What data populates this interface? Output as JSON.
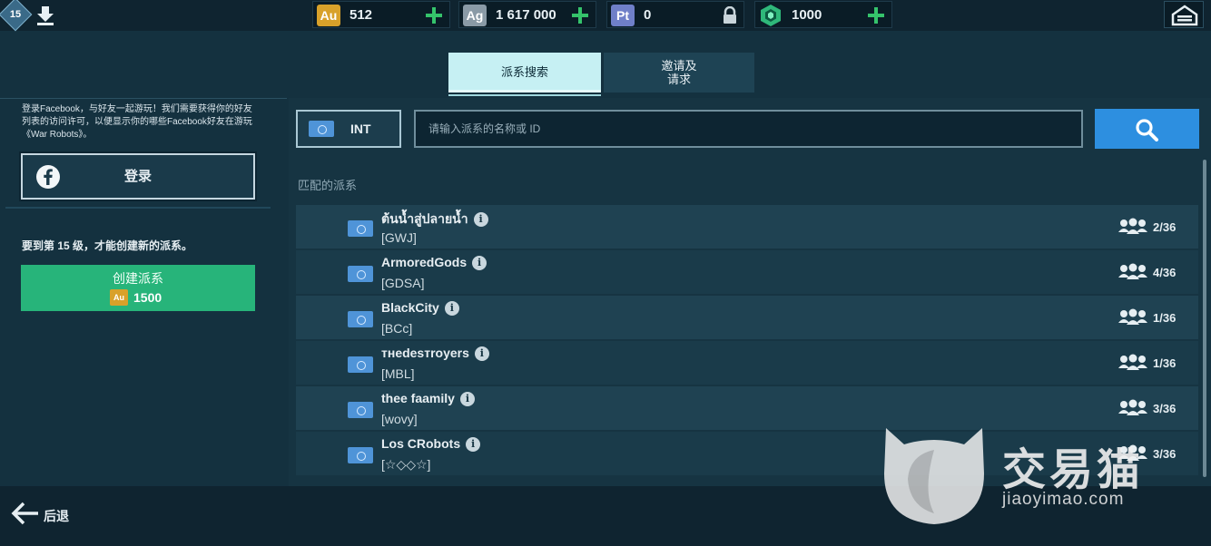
{
  "topbar": {
    "level": "15",
    "currencies": [
      {
        "icon_label": "Au",
        "name": "gold",
        "value": "512",
        "color": "#d8a12a",
        "action": "plus"
      },
      {
        "icon_label": "Ag",
        "name": "silver",
        "value": "1 617 000",
        "color": "#8a9aa6",
        "action": "plus"
      },
      {
        "icon_label": "Pt",
        "name": "platinum",
        "value": "0",
        "color": "#6f7fc8",
        "action": "lock"
      },
      {
        "icon_label": "",
        "name": "keys",
        "value": "1000",
        "color": "#2fb87a",
        "action": "plus"
      }
    ],
    "icons": {
      "download": "download-arrow-icon",
      "home": "hangar-icon",
      "plus": "plus-icon",
      "lock": "lock-icon"
    }
  },
  "tabs": [
    {
      "label": "派系搜索",
      "active": true
    },
    {
      "label": "邀请及\n请求",
      "active": false
    }
  ],
  "left_panel": {
    "facebook_text": "登录Facebook，与好友一起游玩！我们需要获得你的好友列表的访问许可，以便显示你的哪些Facebook好友在游玩《War Robots》。",
    "login_label": "登录",
    "level_requirement": "要到第 15 级，才能创建新的派系。",
    "create_label": "创建派系",
    "create_cost_icon": "Au",
    "create_cost": "1500",
    "colors": {
      "create_button": "#27b47a"
    }
  },
  "search": {
    "region_label": "INT",
    "placeholder": "请输入派系的名称或 ID",
    "value": "",
    "section_label": "匹配的派系",
    "accent": "#2d8fe0"
  },
  "clans": [
    {
      "name": "ต้นน้ำสู่ปลายน้ำ",
      "tag": "[GWJ]",
      "members": "2/36"
    },
    {
      "name": "ArmoredGods",
      "tag": "[GDSA]",
      "members": "4/36"
    },
    {
      "name": "BlackCity",
      "tag": "[BCc]",
      "members": "1/36"
    },
    {
      "name": "тнеdesтroyers",
      "tag": "[MBL]",
      "members": "1/36"
    },
    {
      "name": "thee faamily",
      "tag": "[wovy]",
      "members": "3/36"
    },
    {
      "name": "Los CRobots",
      "tag": "[☆◇◇☆]",
      "members": "3/36"
    }
  ],
  "info_glyph": "i",
  "bottom": {
    "back_label": "后退"
  },
  "watermark": {
    "brand": "交易猫",
    "url": "jiaoyimao.com"
  }
}
